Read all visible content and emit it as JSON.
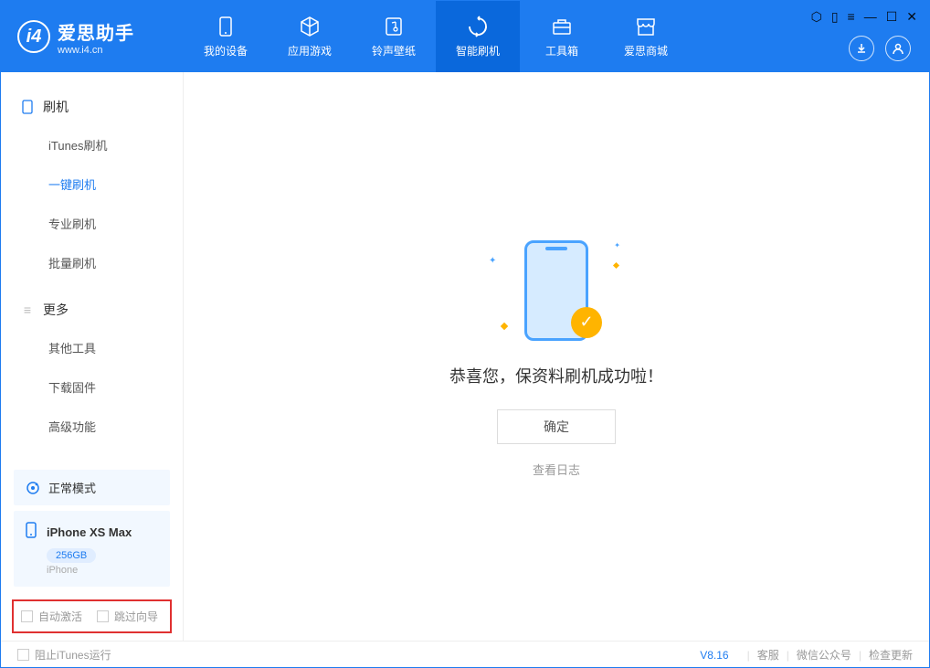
{
  "app": {
    "title": "爱思助手",
    "subtitle": "www.i4.cn"
  },
  "tabs": [
    {
      "label": "我的设备",
      "icon": "device"
    },
    {
      "label": "应用游戏",
      "icon": "cube"
    },
    {
      "label": "铃声壁纸",
      "icon": "music"
    },
    {
      "label": "智能刷机",
      "icon": "refresh",
      "active": true
    },
    {
      "label": "工具箱",
      "icon": "toolbox"
    },
    {
      "label": "爱思商城",
      "icon": "store"
    }
  ],
  "sidebar": {
    "section1": {
      "title": "刷机"
    },
    "items1": [
      {
        "label": "iTunes刷机"
      },
      {
        "label": "一键刷机",
        "active": true
      },
      {
        "label": "专业刷机"
      },
      {
        "label": "批量刷机"
      }
    ],
    "section2": {
      "title": "更多"
    },
    "items2": [
      {
        "label": "其他工具"
      },
      {
        "label": "下载固件"
      },
      {
        "label": "高级功能"
      }
    ]
  },
  "device": {
    "mode": "正常模式",
    "name": "iPhone XS Max",
    "storage": "256GB",
    "type": "iPhone"
  },
  "checkboxes": {
    "auto_activate": "自动激活",
    "skip_guide": "跳过向导"
  },
  "main": {
    "success_message": "恭喜您，保资料刷机成功啦！",
    "confirm_button": "确定",
    "view_log": "查看日志"
  },
  "footer": {
    "block_itunes": "阻止iTunes运行",
    "version": "V8.16",
    "customer_service": "客服",
    "wechat": "微信公众号",
    "check_update": "检查更新"
  }
}
